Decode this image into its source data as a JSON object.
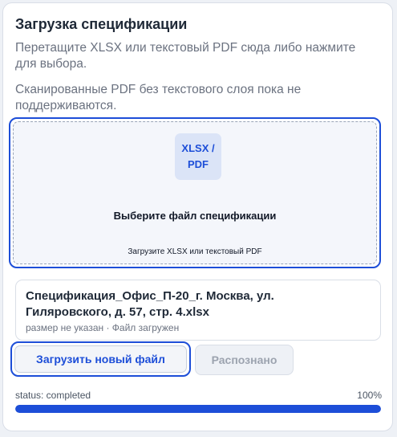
{
  "title": "Загрузка спецификации",
  "hints": [
    "Перетащите XLSX или текстовый PDF сюда либо нажмите для выбора.",
    "Сканированные PDF без текстового слоя пока не поддерживаются."
  ],
  "dropzone": {
    "badge_line1": "XLSX /",
    "badge_line2": "PDF",
    "title": "Выберите файл спецификации",
    "subtitle": "Загрузите XLSX или текстовый PDF"
  },
  "file": {
    "name": "Спецификация_Офис_П-20_г. Москва, ул. Гиляровского, д. 57, стр. 4.xlsx",
    "meta": "размер не указан · Файл загружен"
  },
  "buttons": {
    "upload_new": "Загрузить новый файл",
    "recognized": "Распознано"
  },
  "status": {
    "text": "status: completed",
    "percent_label": "100%",
    "progress": 1.0
  },
  "colors": {
    "accent": "#1d4ed8"
  }
}
